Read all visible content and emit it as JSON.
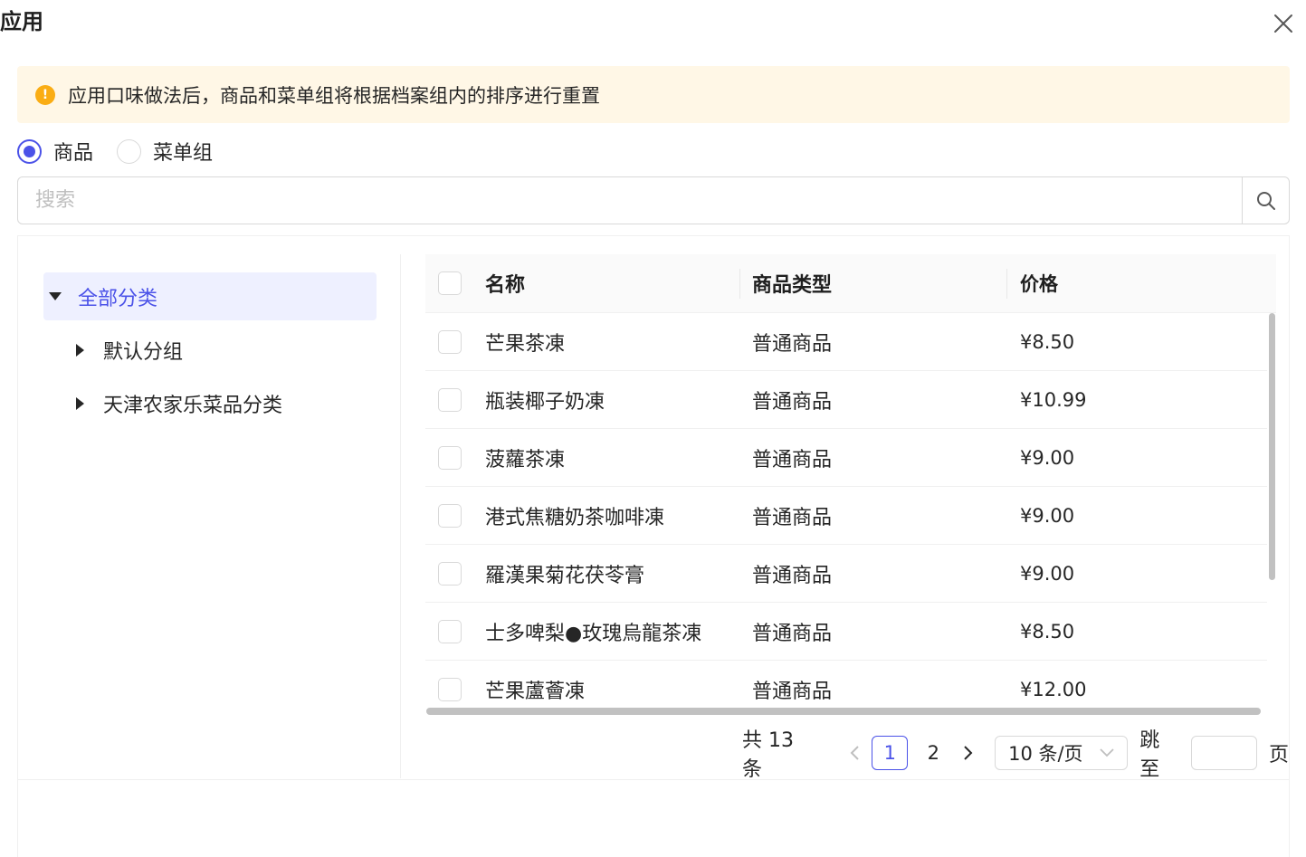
{
  "dialog": {
    "title": "应用"
  },
  "alert": {
    "text": "应用口味做法后，商品和菜单组将根据档案组内的排序进行重置"
  },
  "radio": {
    "options": [
      {
        "label": "商品",
        "checked": true
      },
      {
        "label": "菜单组",
        "checked": false
      }
    ]
  },
  "search": {
    "placeholder": "搜索"
  },
  "tree": {
    "root": {
      "label": "全部分类"
    },
    "children": [
      {
        "label": "默认分组"
      },
      {
        "label": "天津农家乐菜品分类"
      }
    ]
  },
  "table": {
    "headers": {
      "name": "名称",
      "type": "商品类型",
      "price": "价格"
    },
    "rows": [
      {
        "name": "芒果茶凍",
        "type": "普通商品",
        "price": "¥8.50"
      },
      {
        "name": "瓶装椰子奶凍",
        "type": "普通商品",
        "price": "¥10.99"
      },
      {
        "name": "菠蘿茶凍",
        "type": "普通商品",
        "price": "¥9.00"
      },
      {
        "name": "港式焦糖奶茶咖啡凍",
        "type": "普通商品",
        "price": "¥9.00"
      },
      {
        "name": "羅漢果菊花茯苓膏",
        "type": "普通商品",
        "price": "¥9.00"
      },
      {
        "name": "士多啤梨●玫瑰烏龍茶凍",
        "type": "普通商品",
        "price": "¥8.50"
      },
      {
        "name": "芒果蘆薈凍",
        "type": "普通商品",
        "price": "¥12.00"
      }
    ]
  },
  "pagination": {
    "total": "共 13 条",
    "pages": [
      "1",
      "2"
    ],
    "current": "1",
    "page_size": "10 条/页",
    "jump_label": "跳至",
    "page_label": "页"
  },
  "colors": {
    "primary": "#4b52e8",
    "warning": "#faad14",
    "alert_bg": "#fff7e6"
  }
}
